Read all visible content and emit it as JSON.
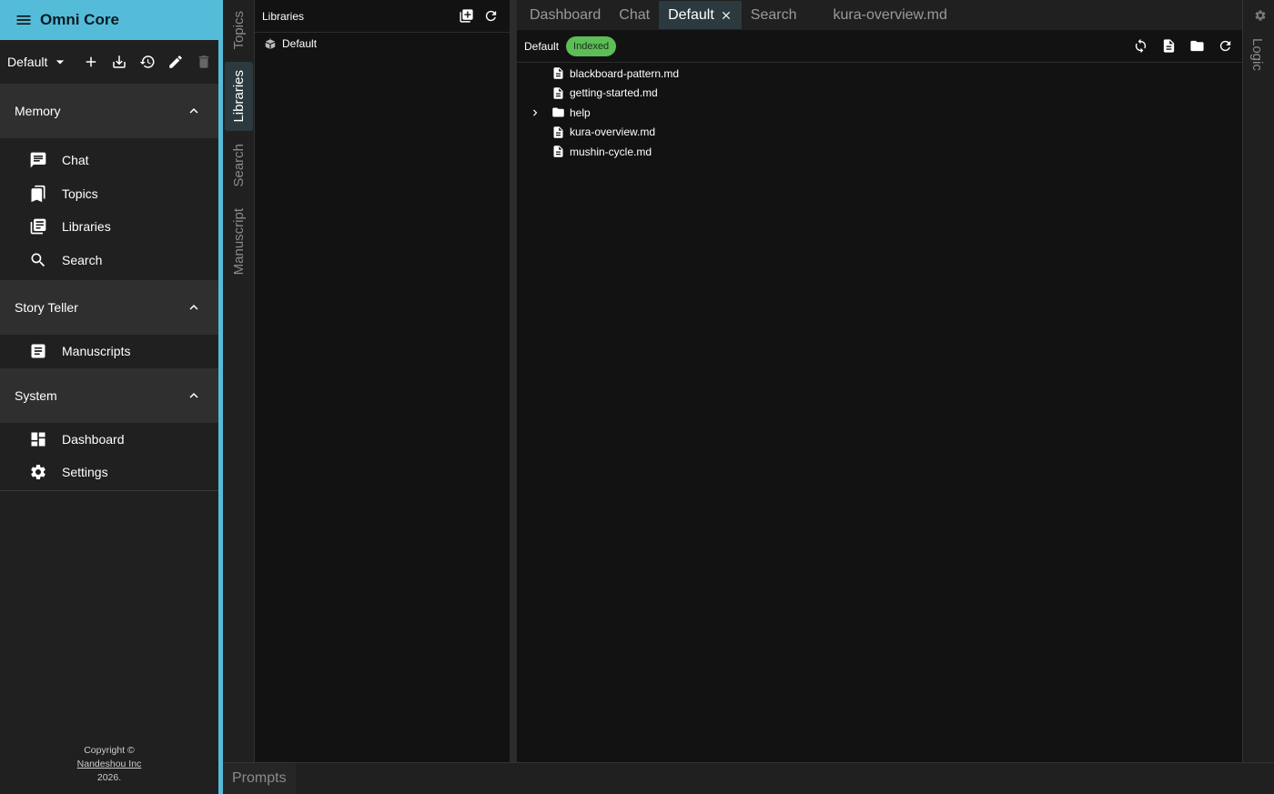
{
  "app": {
    "title": "Omni Core"
  },
  "workspace": {
    "selected": "Default"
  },
  "sidebar": {
    "groups": [
      {
        "label": "Memory",
        "items": [
          {
            "label": "Chat",
            "icon": "chat-icon"
          },
          {
            "label": "Topics",
            "icon": "bookmarks-icon"
          },
          {
            "label": "Libraries",
            "icon": "library-books-icon"
          },
          {
            "label": "Search",
            "icon": "search-icon"
          }
        ]
      },
      {
        "label": "Story Teller",
        "items": [
          {
            "label": "Manuscripts",
            "icon": "article-icon"
          }
        ]
      },
      {
        "label": "System",
        "items": [
          {
            "label": "Dashboard",
            "icon": "dashboard-icon"
          },
          {
            "label": "Settings",
            "icon": "settings-gear-icon"
          }
        ]
      }
    ]
  },
  "footer": {
    "line1": "Copyright ©",
    "company": "Nandeshou Inc",
    "year": "2026."
  },
  "vtabs": [
    "Topics",
    "Libraries",
    "Search",
    "Manuscript"
  ],
  "libraries": {
    "title": "Libraries",
    "items": [
      "Default"
    ]
  },
  "main": {
    "tabs": [
      "Dashboard",
      "Chat",
      "Default",
      "Search",
      "kura-overview.md"
    ],
    "active_tab": "Default",
    "library_name": "Default",
    "status": "Indexed",
    "tree": [
      {
        "name": "blackboard-pattern.md",
        "type": "file"
      },
      {
        "name": "getting-started.md",
        "type": "file"
      },
      {
        "name": "help",
        "type": "folder"
      },
      {
        "name": "kura-overview.md",
        "type": "file"
      },
      {
        "name": "mushin-cycle.md",
        "type": "file"
      }
    ]
  },
  "right_rail": {
    "label": "Logic"
  },
  "bottom": {
    "label": "Prompts"
  },
  "colors": {
    "accent": "#54bcd9",
    "indexed_badge": "#5dbd57",
    "active_tab": "#2b3a3f"
  }
}
